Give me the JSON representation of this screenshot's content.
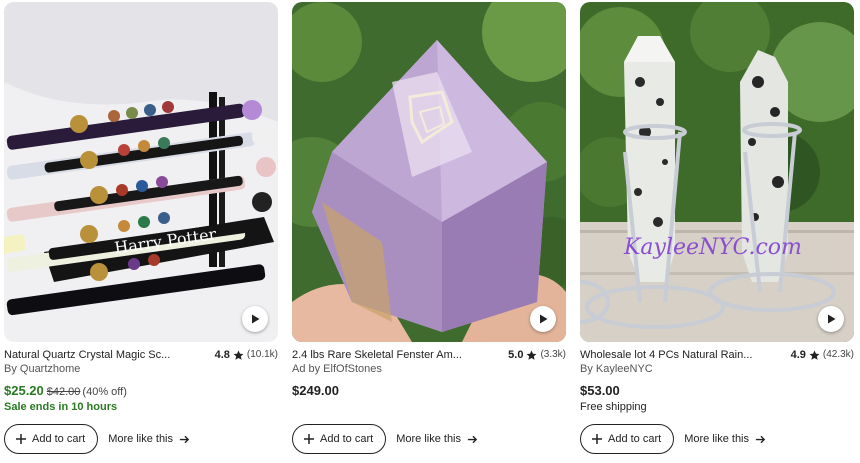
{
  "listings": [
    {
      "image_alt": "Harry Potter crystal wands on black stand",
      "title": "Natural Quartz Crystal Magic Sc...",
      "rating": "4.8",
      "review_count": "(10.1k)",
      "seller": "By Quartzhome",
      "price": "$25.20",
      "original_price": "$42.00",
      "discount": "(40% off)",
      "note": "Sale ends in 10 hours",
      "add_label": "Add to cart",
      "more_label": "More like this"
    },
    {
      "image_alt": "Amethyst skeletal fenster crystal in hand",
      "title": "2.4 lbs Rare Skeletal Fenster Am...",
      "rating": "5.0",
      "review_count": "(3.3k)",
      "seller": "Ad by ElfOfStones",
      "price": "$249.00",
      "original_price": "",
      "discount": "",
      "note": "",
      "add_label": "Add to cart",
      "more_label": "More like this"
    },
    {
      "image_alt": "Rainbow quartz points on metal stands",
      "title": "Wholesale lot 4 PCs Natural Rain...",
      "rating": "4.9",
      "review_count": "(42.3k)",
      "seller": "By KayleeNYC",
      "price": "$53.00",
      "original_price": "",
      "discount": "",
      "note": "Free shipping",
      "watermark": "KayleeNYC.com",
      "add_label": "Add to cart",
      "more_label": "More like this"
    }
  ],
  "colors": {
    "sale_green": "#2a7a25",
    "text": "#222222"
  },
  "icons": [
    "play-icon",
    "star-icon",
    "plus-icon",
    "arrow-right-icon"
  ]
}
